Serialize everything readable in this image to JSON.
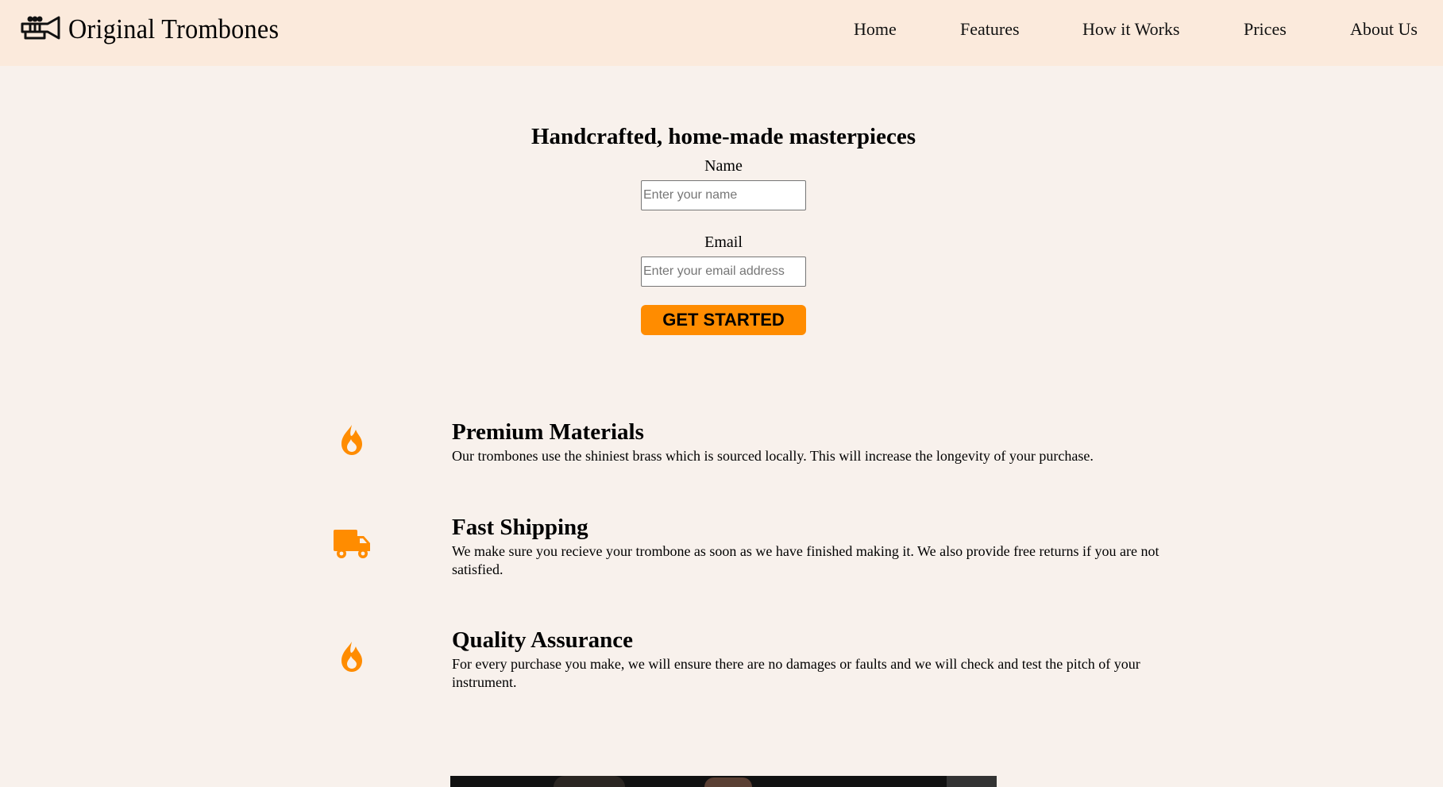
{
  "header": {
    "brand_name": "Original Trombones",
    "logo_icon": "trumpet-icon",
    "nav": [
      {
        "label": "Home"
      },
      {
        "label": "Features"
      },
      {
        "label": "How it Works"
      },
      {
        "label": "Prices"
      },
      {
        "label": "About Us"
      }
    ]
  },
  "hero": {
    "title": "Handcrafted, home-made masterpieces",
    "form": {
      "name_label": "Name",
      "name_placeholder": "Enter your name",
      "email_label": "Email",
      "email_placeholder": "Enter your email address",
      "submit_label": "GET STARTED"
    }
  },
  "features": [
    {
      "icon": "flame-icon",
      "title": "Premium Materials",
      "text": "Our trombones use the shiniest brass which is sourced locally. This will increase the longevity of your purchase."
    },
    {
      "icon": "truck-icon",
      "title": "Fast Shipping",
      "text": "We make sure you recieve your trombone as soon as we have finished making it. We also provide free returns if you are not satisfied."
    },
    {
      "icon": "flame-icon",
      "title": "Quality Assurance",
      "text": "For every purchase you make, we will ensure there are no damages or faults and we will check and test the pitch of your instrument."
    }
  ],
  "colors": {
    "header_bg": "#fbeadc",
    "page_bg": "#f8f1ec",
    "accent": "#ff8c00"
  }
}
